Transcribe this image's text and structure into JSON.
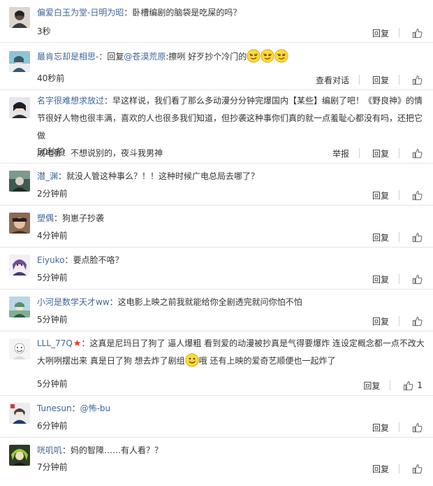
{
  "colors": {
    "username": "#406599",
    "text": "#333333",
    "divider": "#e6e6e6",
    "star_badge": "#e8381b"
  },
  "comments": [
    {
      "user": "偏爱白玉为堂-日明为昭",
      "text": "：卧槽编剧的脑袋是吃屎的吗？",
      "time": "3秒",
      "actions": [
        "回复"
      ]
    },
    {
      "user": "最肯忘却是相思-",
      "text_prefix": "：回复",
      "mention": "@苍漠荒原",
      "text": ":擦咧 好歹抄个冷门的",
      "emoji_count": 3,
      "emoji_icon": "smirk-emoji-icon",
      "time": "40秒前",
      "actions": [
        "查看对话",
        "回复"
      ]
    },
    {
      "user": "名字很难想求放过",
      "text_line1": "：早这样说，我们看了那么多动漫分分钟完爆国内【某些】编剧了吧！《野良神》的情",
      "text_line2": "节很好人物也很丰满，喜欢的人也很多我们知道，但抄袭这种事你们真的就一点羞耻心都没有吗，还把它做",
      "text_line3": "成电影！不想说别的，夜斗我男神",
      "time": "50秒前",
      "actions": [
        "举报",
        "回复"
      ]
    },
    {
      "user": "潜_渊",
      "text": "：就没人管这种事么？！！这种时候广电总局去哪了？",
      "time": "2分钟前",
      "actions": [
        "回复"
      ]
    },
    {
      "user": "塑偶",
      "text": "：狗崽子抄袭",
      "time": "4分钟前",
      "actions": [
        "回复"
      ]
    },
    {
      "user": "Eiyuko",
      "text": "：要点脸不咯？",
      "time": "5分钟前",
      "actions": [
        "回复"
      ]
    },
    {
      "user": "小河是数学天才ww",
      "text": "：这电影上映之前我就能给你全剧透完就问你怕不怕",
      "time": "5分钟前",
      "actions": [
        "回复"
      ]
    },
    {
      "user": "LLL_77Q",
      "badge_icon": "red-star-icon",
      "text_line1": "：这真是尼玛日了狗了 逼人爆粗 看到爱的动漫被抄真是气得要爆炸 连设定概念都一点不改大",
      "text_line2_a": "大咧咧摆出来 真是日了狗 想去炸了剧组",
      "emoji_icon": "smile-emoji-icon",
      "text_line2_b": "哦 还有上映的爱奇艺顺便也一起炸了",
      "time": "5分钟前",
      "actions": [
        "回复"
      ],
      "likes": "1"
    },
    {
      "user": "Tunesun",
      "text_prefix": "：",
      "mention": "@怖-bu",
      "time": "6分钟前",
      "actions": [
        "回复"
      ]
    },
    {
      "user": "咣叽叽",
      "text": "：妈的智障……有人看？？",
      "time": "7分钟前",
      "actions": [
        "回复"
      ]
    }
  ]
}
